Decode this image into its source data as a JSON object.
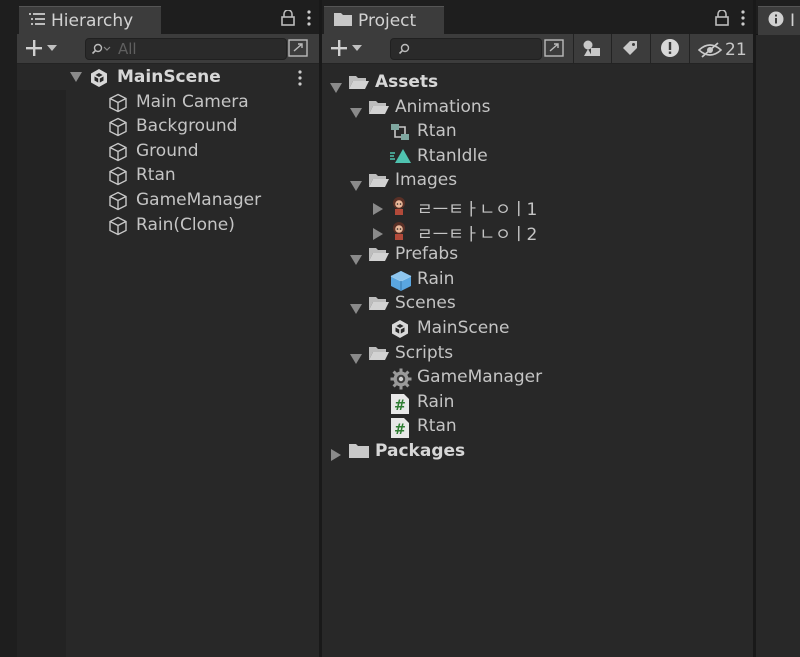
{
  "hierarchy": {
    "tab_label": "Hierarchy",
    "search_placeholder": "All",
    "scene": "MainScene",
    "objects": [
      "Main Camera",
      "Background",
      "Ground",
      "Rtan",
      "GameManager",
      "Rain(Clone)"
    ]
  },
  "project": {
    "tab_label": "Project",
    "hidden_count": "21",
    "assets_label": "Assets",
    "packages_label": "Packages",
    "folders": [
      {
        "name": "Animations",
        "items": [
          "Rtan",
          "RtanIdle"
        ]
      },
      {
        "name": "Images",
        "items": [
          "ㄹㅡㅌㅏㄴㅇㅣ1",
          "ㄹㅡㅌㅏㄴㅇㅣ2"
        ]
      },
      {
        "name": "Prefabs",
        "items": [
          "Rain"
        ]
      },
      {
        "name": "Scenes",
        "items": [
          "MainScene"
        ]
      },
      {
        "name": "Scripts",
        "items": [
          "GameManager",
          "Rain",
          "Rtan"
        ]
      }
    ]
  },
  "inspector": {
    "tab_label": "I"
  },
  "colors": {
    "panel": "#282828",
    "tab_active": "#3c3c3c",
    "toolbar": "#3c3c3c",
    "text": "#c4c4c4",
    "anim_accent": "#4fc3b0",
    "prefab_blue": "#5aa6e0",
    "script_green": "#2e7d32"
  },
  "icons": {
    "hierarchy_tab": "list-icon",
    "project_tab": "folder-icon",
    "lock": "lock-icon",
    "menu": "kebab-menu-icon",
    "search": "search-icon",
    "popout": "popout-icon",
    "unity_scene": "unity-logo-icon",
    "gameobject": "cube-icon",
    "folder": "folder-icon",
    "anim_controller": "animator-controller-icon",
    "anim_clip": "animation-clip-icon",
    "sprite": "sprite-thumbnail-icon",
    "prefab": "prefab-cube-icon",
    "script": "csharp-script-icon",
    "gear": "gear-icon",
    "filter_type": "filter-by-type-icon",
    "filter_label": "filter-by-label-icon",
    "warning": "warning-icon",
    "hidden": "eye-hidden-icon"
  }
}
